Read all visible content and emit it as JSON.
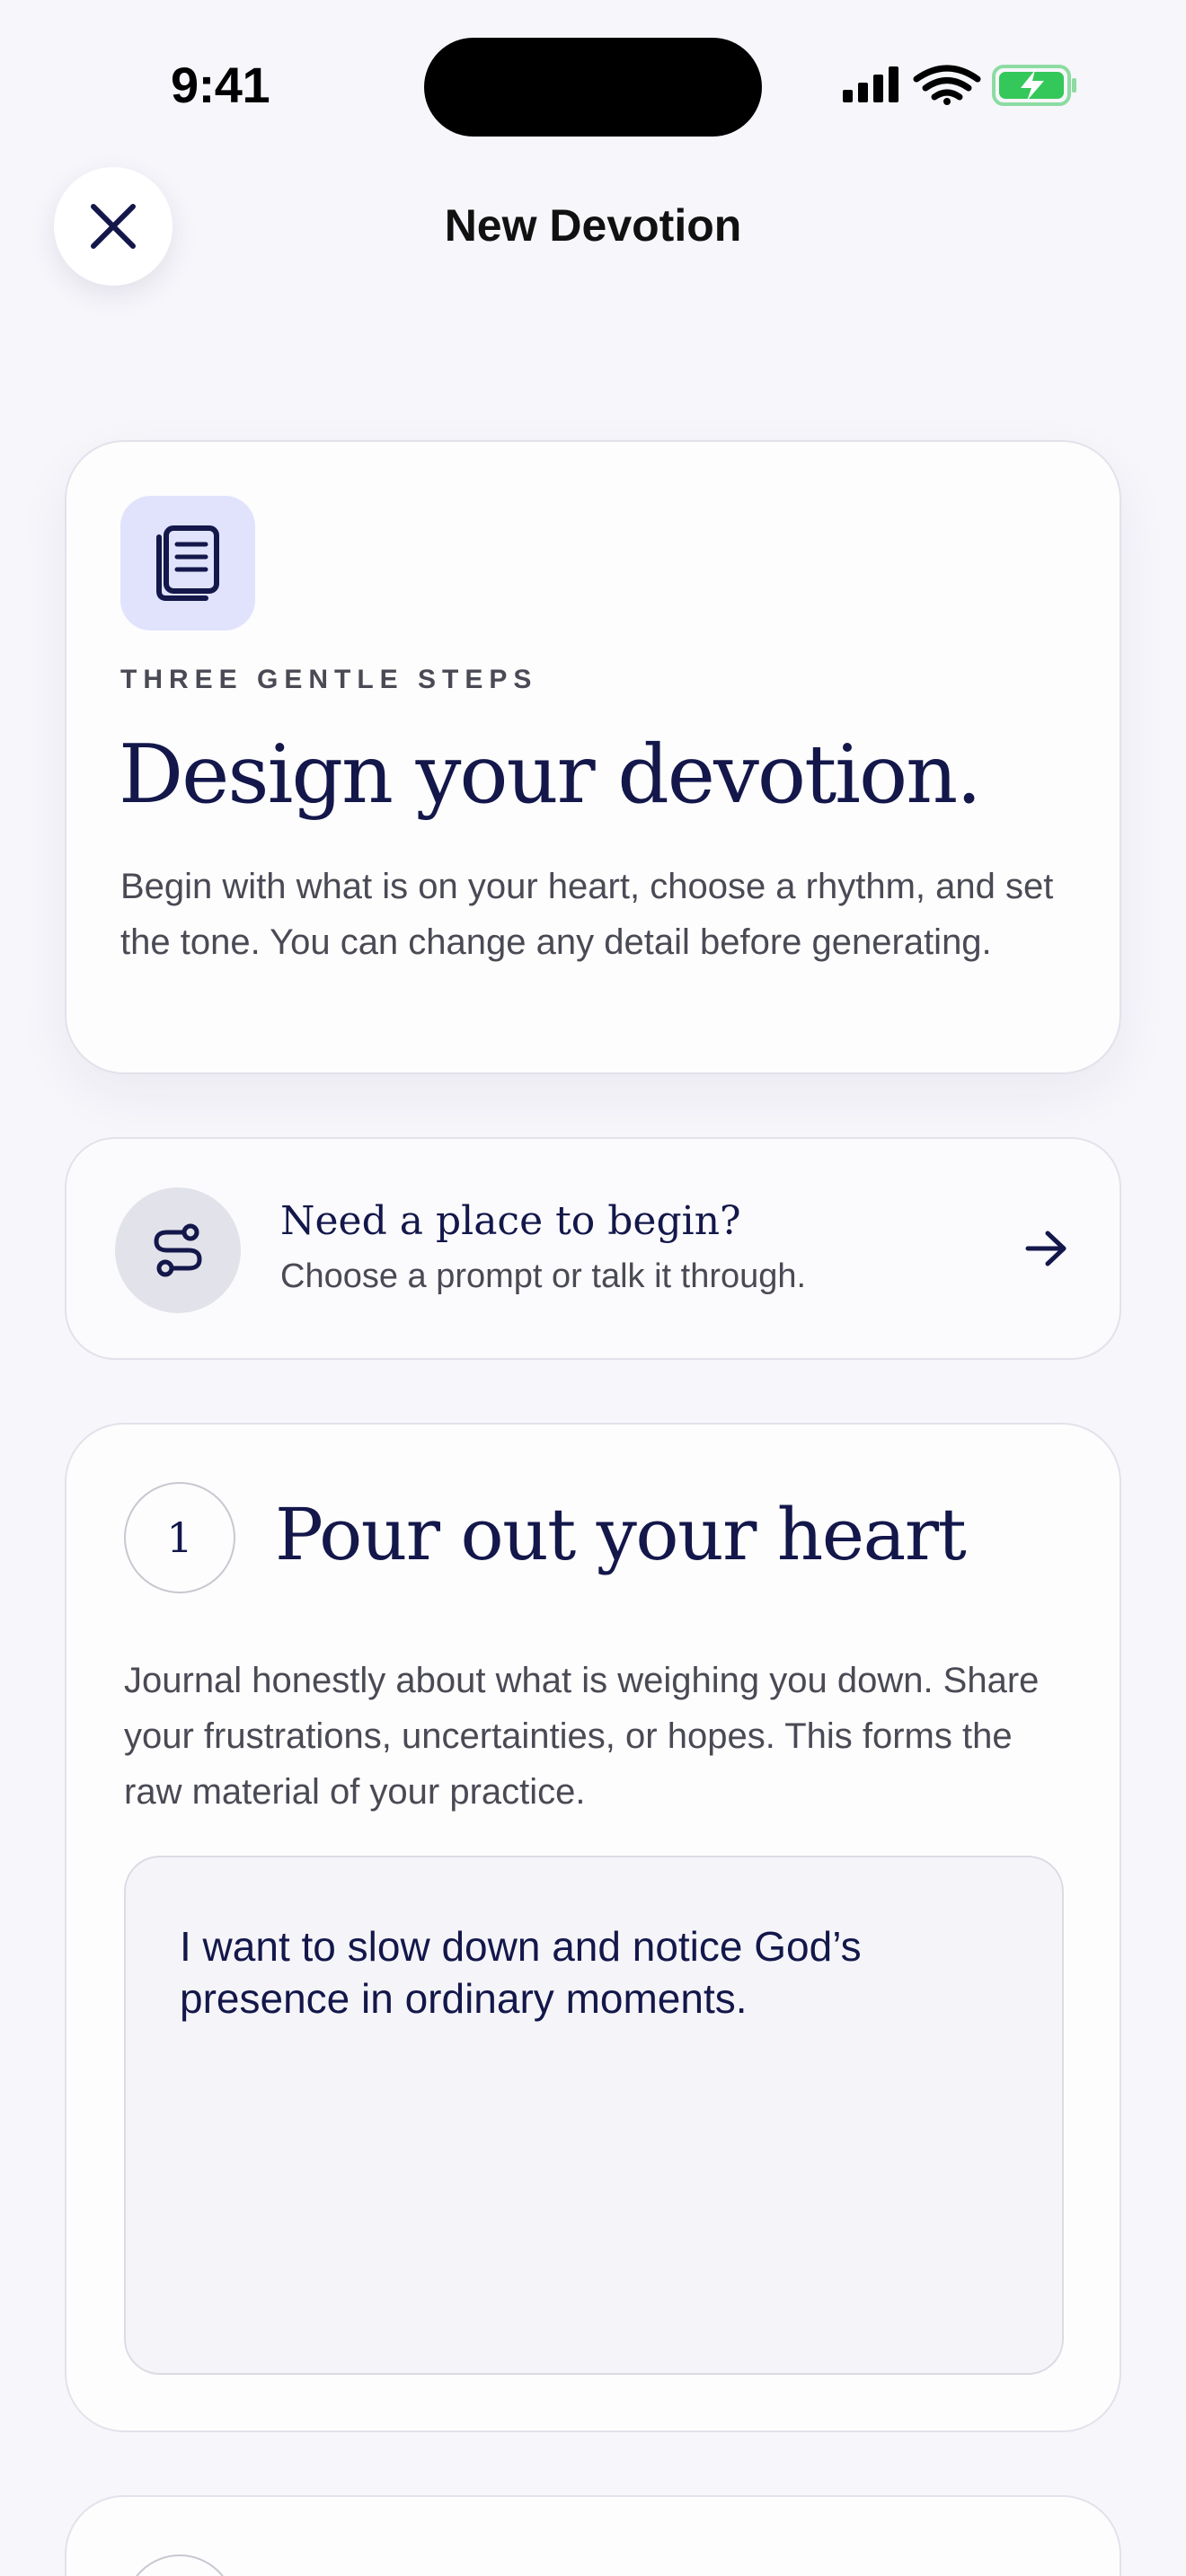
{
  "status_bar": {
    "time": "9:41",
    "icons": [
      "cellular-signal-icon",
      "wifi-icon",
      "battery-charging-icon"
    ],
    "battery_color": "#34c759"
  },
  "header": {
    "close_icon": "close-icon",
    "title": "New Devotion"
  },
  "intro": {
    "icon": "document-stack-icon",
    "eyebrow": "THREE GENTLE STEPS",
    "title": "Design your devotion.",
    "body": "Begin with what is on your heart, choose a rhythm, and set the tone. You can change any detail before generating."
  },
  "prompt": {
    "icon": "path-icon",
    "title": "Need a place to begin?",
    "subtitle": "Choose a prompt or talk it through.",
    "arrow_icon": "arrow-right-icon"
  },
  "step1": {
    "number": "1",
    "title": "Pour out your heart",
    "body": "Journal honestly about what is weighing you down. Share your frustrations, uncertainties, or hopes. This forms the raw material of your practice.",
    "journal_text": "I want to slow down and notice God’s presence in ordinary moments."
  },
  "colors": {
    "accent_navy": "#13174a",
    "tile_lavender": "#e0e3fb",
    "background": "#f7f6fb"
  }
}
